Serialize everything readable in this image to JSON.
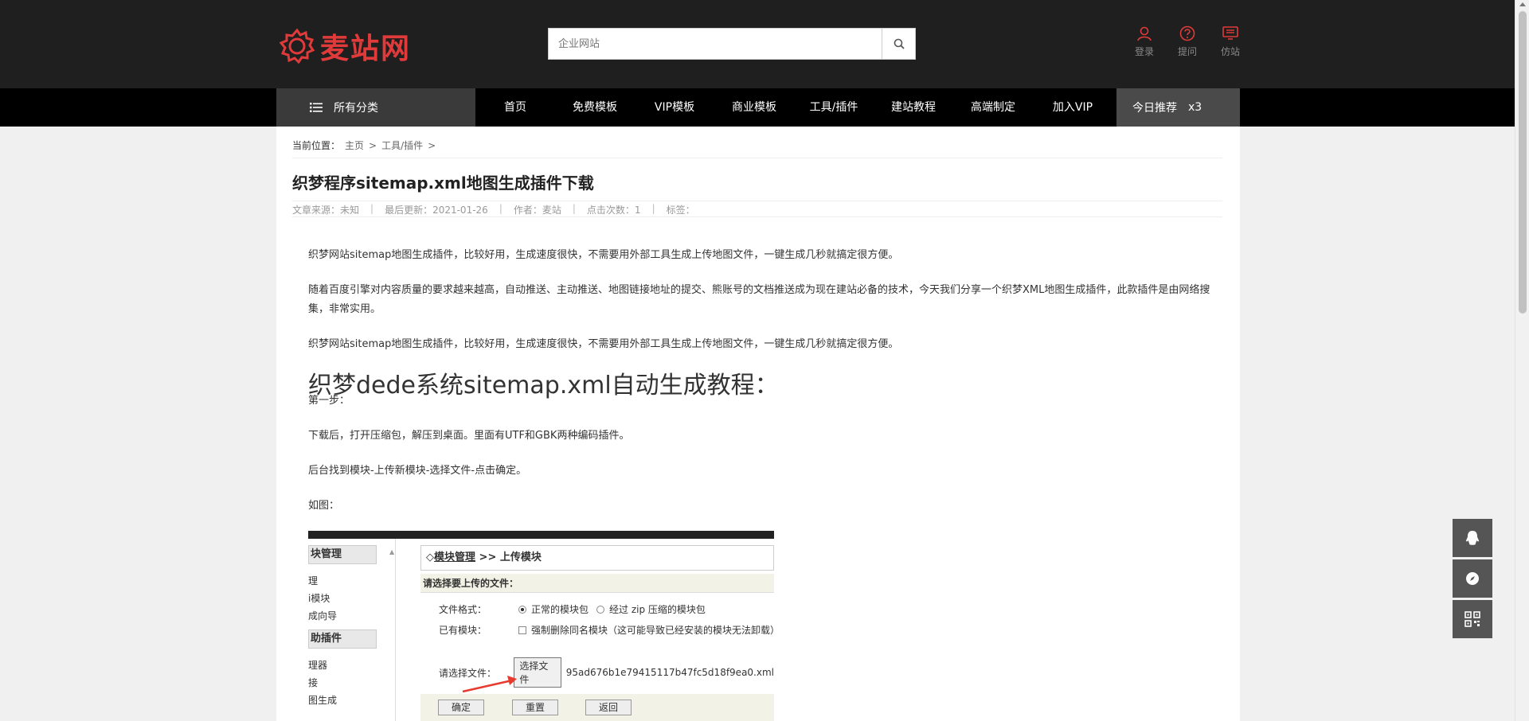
{
  "header": {
    "logo_text": "麦站网",
    "search_placeholder": "企业网站",
    "user_links": [
      {
        "label": "登录",
        "icon": "user-icon"
      },
      {
        "label": "提问",
        "icon": "question-icon"
      },
      {
        "label": "仿站",
        "icon": "monitor-icon"
      }
    ],
    "brand_color": "#e03a3a"
  },
  "nav": {
    "category_label": "所有分类",
    "items": [
      "首页",
      "免费模板",
      "VIP模板",
      "商业模板",
      "工具/插件",
      "建站教程",
      "高端制定",
      "加入VIP"
    ],
    "today_label": "今日推荐",
    "today_count": "x3"
  },
  "breadcrumb": {
    "prefix": "当前位置：",
    "items": [
      "主页",
      "工具/插件"
    ]
  },
  "article": {
    "title": "织梦程序sitemap.xml地图生成插件下载",
    "meta": {
      "source": "文章来源：未知",
      "updated": "最后更新：2021-01-26",
      "author": "作者：麦站",
      "clicks": "点击次数：1",
      "tags": "标签："
    },
    "paragraphs": [
      "织梦网站sitemap地图生成插件，比较好用，生成速度很快，不需要用外部工具生成上传地图文件，一键生成几秒就搞定很方便。",
      "随着百度引擎对内容质量的要求越来越高，自动推送、主动推送、地图链接地址的提交、熊账号的文档推送成为现在建站必备的技术，今天我们分享一个织梦XML地图生成插件，此款插件是由网络搜集，非常实用。",
      "织梦网站sitemap地图生成插件，比较好用，生成速度很快，不需要用外部工具生成上传地图文件，一键生成几秒就搞定很方便。"
    ],
    "heading": "织梦dede系统sitemap.xml自动生成教程：",
    "step1": "第一步：",
    "step_text1": "下载后，打开压缩包，解压到桌面。里面有UTF和GBK两种编码插件。",
    "step_text2": "后台找到模块-上传新模块-选择文件-点击确定。",
    "step_text3": "如图："
  },
  "screenshot": {
    "left_headers": [
      "块管理",
      "助插件"
    ],
    "left_items": [
      "理",
      "i模块",
      "成向导",
      "理器",
      "接",
      "图生成"
    ],
    "right_title_mark": "◇",
    "right_title_link": "模块管理",
    "right_title_sep": ">>",
    "right_title_rest": "上传模块",
    "sub_header": "请选择要上传的文件：",
    "file_format_label": "文件格式：",
    "option_normal": "正常的模块包",
    "option_zip": "经过 zip 压缩的模块包",
    "existing_label": "已有模块：",
    "existing_option": "强制删除同名模块（这可能导致已经安装的模块无法卸载）",
    "choose_label": "请选择文件：",
    "choose_button": "选择文件",
    "chosen_file": "95ad676b1e79415117b47fc5d18f9ea0.xml",
    "buttons": [
      "确定",
      "重置",
      "返回"
    ]
  },
  "floating": [
    "qq-icon",
    "compass-icon",
    "qrcode-icon"
  ]
}
